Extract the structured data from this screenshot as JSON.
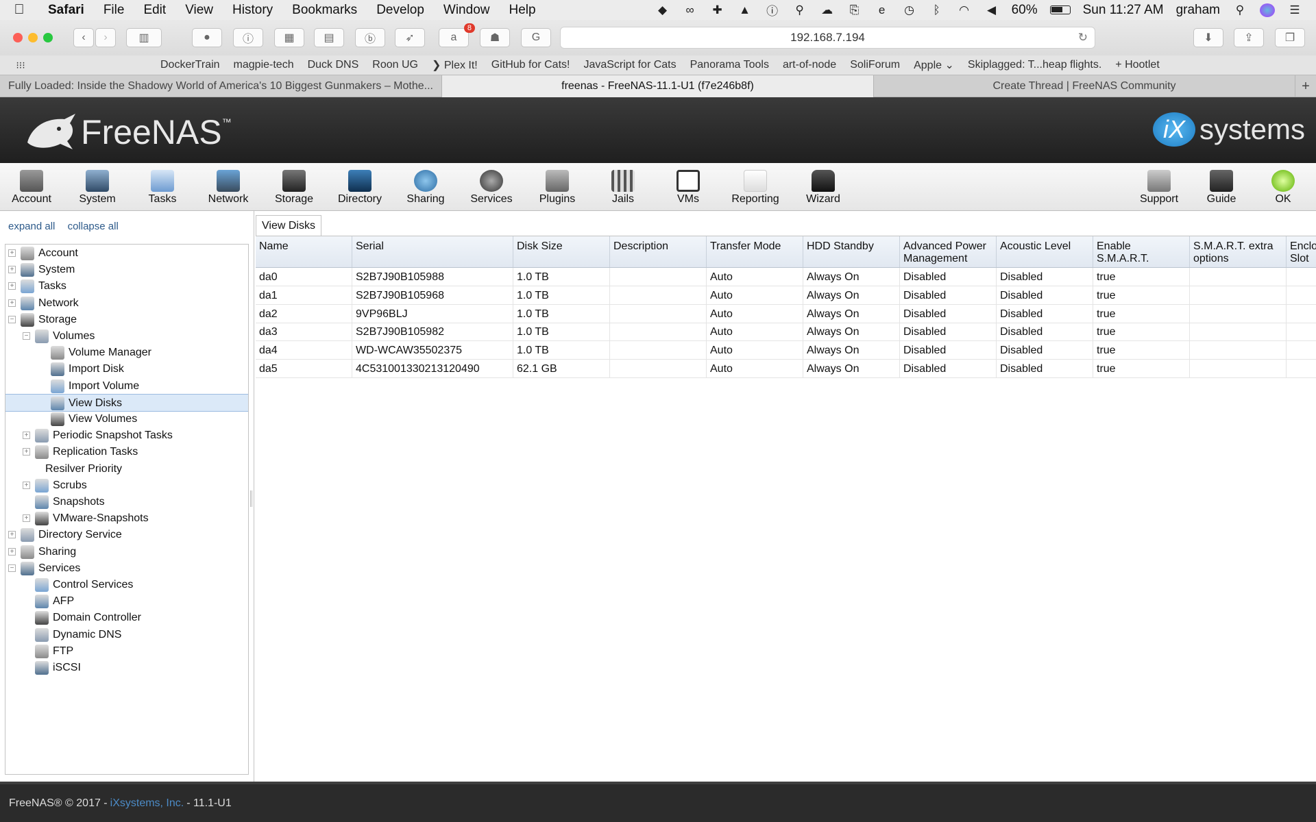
{
  "menubar": {
    "app": "Safari",
    "items": [
      "File",
      "Edit",
      "View",
      "History",
      "Bookmarks",
      "Develop",
      "Window",
      "Help"
    ],
    "battery": "60%",
    "clock": "Sun 11:27 AM",
    "user": "graham"
  },
  "toolbar": {
    "url": "192.168.7.194",
    "badge": "8"
  },
  "favorites": [
    "DockerTrain",
    "magpie-tech",
    "Duck DNS",
    "Roon UG",
    "❯ Plex It!",
    "GitHub for Cats!",
    "JavaScript for Cats",
    "Panorama Tools",
    "art-of-node",
    "SoliForum",
    "Apple ⌄",
    "Skiplagged: T...heap flights.",
    "+ Hootlet"
  ],
  "tabs": [
    "Fully Loaded: Inside the Shadowy World of America's 10 Biggest Gunmakers – Mothe...",
    "freenas - FreeNAS-11.1-U1 (f7e246b8f)",
    "Create Thread | FreeNAS Community"
  ],
  "header": {
    "logo": "FreeNAS",
    "logo_mark": "™",
    "vendor": "systems"
  },
  "iconbar": {
    "left": [
      "Account",
      "System",
      "Tasks",
      "Network",
      "Storage",
      "Directory",
      "Sharing",
      "Services",
      "Plugins",
      "Jails",
      "VMs",
      "Reporting",
      "Wizard"
    ],
    "right": [
      "Support",
      "Guide",
      "OK"
    ]
  },
  "sidebar": {
    "expand_all": "expand all",
    "collapse_all": "collapse all",
    "tree": [
      {
        "label": "Account",
        "level": 0,
        "toggle": "+"
      },
      {
        "label": "System",
        "level": 0,
        "toggle": "+"
      },
      {
        "label": "Tasks",
        "level": 0,
        "toggle": "+"
      },
      {
        "label": "Network",
        "level": 0,
        "toggle": "+"
      },
      {
        "label": "Storage",
        "level": 0,
        "toggle": "−"
      },
      {
        "label": "Volumes",
        "level": 1,
        "toggle": "−"
      },
      {
        "label": "Volume Manager",
        "level": 2,
        "toggle": ""
      },
      {
        "label": "Import Disk",
        "level": 2,
        "toggle": ""
      },
      {
        "label": "Import Volume",
        "level": 2,
        "toggle": ""
      },
      {
        "label": "View Disks",
        "level": 2,
        "toggle": "",
        "selected": true
      },
      {
        "label": "View Volumes",
        "level": 2,
        "toggle": ""
      },
      {
        "label": "Periodic Snapshot Tasks",
        "level": 1,
        "toggle": "+"
      },
      {
        "label": "Replication Tasks",
        "level": 1,
        "toggle": "+"
      },
      {
        "label": "Resilver Priority",
        "level": 1,
        "toggle": "",
        "noicon": true
      },
      {
        "label": "Scrubs",
        "level": 1,
        "toggle": "+"
      },
      {
        "label": "Snapshots",
        "level": 1,
        "toggle": ""
      },
      {
        "label": "VMware-Snapshots",
        "level": 1,
        "toggle": "+"
      },
      {
        "label": "Directory Service",
        "level": 0,
        "toggle": "+"
      },
      {
        "label": "Sharing",
        "level": 0,
        "toggle": "+"
      },
      {
        "label": "Services",
        "level": 0,
        "toggle": "−"
      },
      {
        "label": "Control Services",
        "level": 1,
        "toggle": ""
      },
      {
        "label": "AFP",
        "level": 1,
        "toggle": ""
      },
      {
        "label": "Domain Controller",
        "level": 1,
        "toggle": ""
      },
      {
        "label": "Dynamic DNS",
        "level": 1,
        "toggle": ""
      },
      {
        "label": "FTP",
        "level": 1,
        "toggle": ""
      },
      {
        "label": "iSCSI",
        "level": 1,
        "toggle": ""
      }
    ]
  },
  "content": {
    "tab": "View Disks",
    "columns": [
      "Name",
      "Serial",
      "Disk Size",
      "Description",
      "Transfer Mode",
      "HDD Standby",
      "Advanced Power Management",
      "Acoustic Level",
      "Enable S.M.A.R.T.",
      "S.M.A.R.T. extra options",
      "Enclos Slot"
    ],
    "rows": [
      [
        "da0",
        "S2B7J90B105988",
        "1.0 TB",
        "",
        "Auto",
        "Always On",
        "Disabled",
        "Disabled",
        "true",
        "",
        ""
      ],
      [
        "da1",
        "S2B7J90B105968",
        "1.0 TB",
        "",
        "Auto",
        "Always On",
        "Disabled",
        "Disabled",
        "true",
        "",
        ""
      ],
      [
        "da2",
        "9VP96BLJ",
        "1.0 TB",
        "",
        "Auto",
        "Always On",
        "Disabled",
        "Disabled",
        "true",
        "",
        ""
      ],
      [
        "da3",
        "S2B7J90B105982",
        "1.0 TB",
        "",
        "Auto",
        "Always On",
        "Disabled",
        "Disabled",
        "true",
        "",
        ""
      ],
      [
        "da4",
        "WD-WCAW35502375",
        "1.0 TB",
        "",
        "Auto",
        "Always On",
        "Disabled",
        "Disabled",
        "true",
        "",
        ""
      ],
      [
        "da5",
        "4C531001330213120490",
        "62.1 GB",
        "",
        "Auto",
        "Always On",
        "Disabled",
        "Disabled",
        "true",
        "",
        ""
      ]
    ]
  },
  "footer": {
    "prefix": "FreeNAS® © 2017 -",
    "link": "iXsystems, Inc.",
    "suffix": "- 11.1-U1"
  },
  "colors": {
    "header_bg": "#2a2a2a",
    "selection": "#dbe9f8",
    "link": "#2d5a8a",
    "footer_link": "#4c8bc6"
  }
}
